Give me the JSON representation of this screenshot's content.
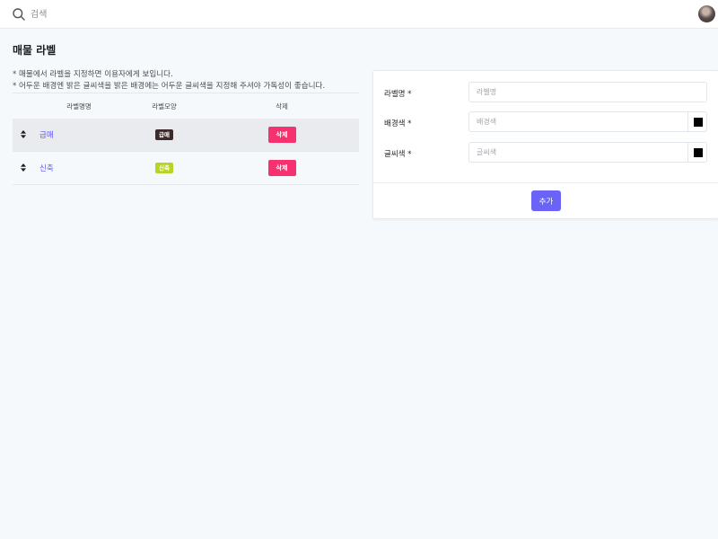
{
  "topbar": {
    "search_placeholder": "검색",
    "search_icon": "search-icon",
    "avatar_icon": "user-avatar"
  },
  "page": {
    "title": "매물 라벨",
    "notes": [
      "* 매물에서 라벨을 지정하면 이용자에게 보입니다.",
      "* 어두운 배경엔 밝은 글씨색을 밝은 배경에는 어두운 글씨색을 지정해 주셔야 가독성이 좋습니다."
    ]
  },
  "table": {
    "headers": {
      "name": "라벨명명",
      "shape": "라벨모양",
      "delete": "삭제"
    },
    "rows": [
      {
        "name": "급매",
        "badge_text": "급매",
        "badge_bg": "#3d2b2b",
        "badge_color": "#ffffff",
        "delete_label": "삭제"
      },
      {
        "name": "신축",
        "badge_text": "신축",
        "badge_bg": "#b8d323",
        "badge_color": "#ffffff",
        "delete_label": "삭제"
      }
    ]
  },
  "form": {
    "name_label": "라벨명 *",
    "name_placeholder": "라벨명",
    "bg_label": "배경색 *",
    "bg_placeholder": "배경색",
    "bg_color": "#000000",
    "text_label": "글씨색 *",
    "text_placeholder": "글씨색",
    "text_color": "#000000",
    "add_label": "추가"
  },
  "colors": {
    "accent": "#6a63f6",
    "danger": "#f5326f",
    "link": "#5a55f5"
  }
}
